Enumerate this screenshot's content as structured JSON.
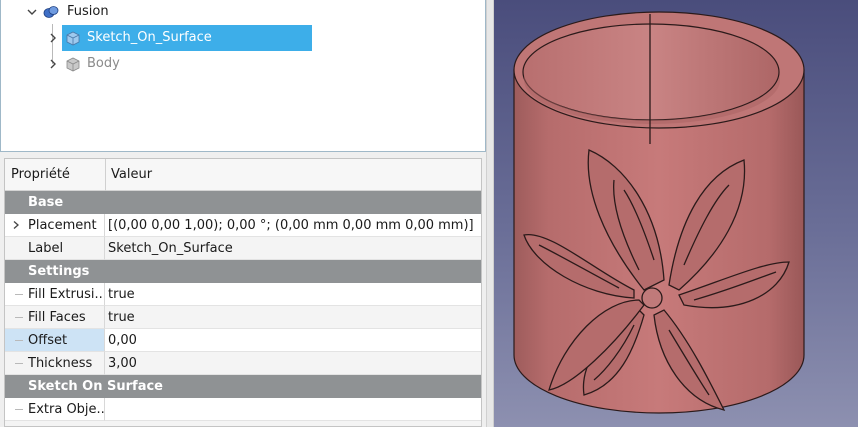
{
  "tree": {
    "fusion_label": "Fusion",
    "sketch_label": "Sketch_On_Surface",
    "body_label": "Body"
  },
  "properties": {
    "header": {
      "property": "Propriété",
      "value": "Valeur"
    },
    "groups": {
      "base": "Base",
      "settings": "Settings",
      "sketch_on_surface": "Sketch On Surface"
    },
    "rows": {
      "placement": {
        "name": "Placement",
        "value": "[(0,00 0,00 1,00); 0,00 °; (0,00 mm  0,00 mm  0,00 mm)]"
      },
      "label": {
        "name": "Label",
        "value": "Sketch_On_Surface"
      },
      "fill_extrusion": {
        "name": "Fill Extrusi...",
        "value": "true"
      },
      "fill_faces": {
        "name": "Fill Faces",
        "value": "true"
      },
      "offset": {
        "name": "Offset",
        "value": "0,00"
      },
      "thickness": {
        "name": "Thickness",
        "value": "3,00"
      },
      "extra_objects": {
        "name": "Extra Obje...",
        "value": ""
      }
    }
  },
  "colors": {
    "selection": "#3daee9",
    "group_row": "#8f9294",
    "model": "#c07474",
    "viewport_top": "#4a4d7c",
    "viewport_bottom": "#8d90b0"
  }
}
